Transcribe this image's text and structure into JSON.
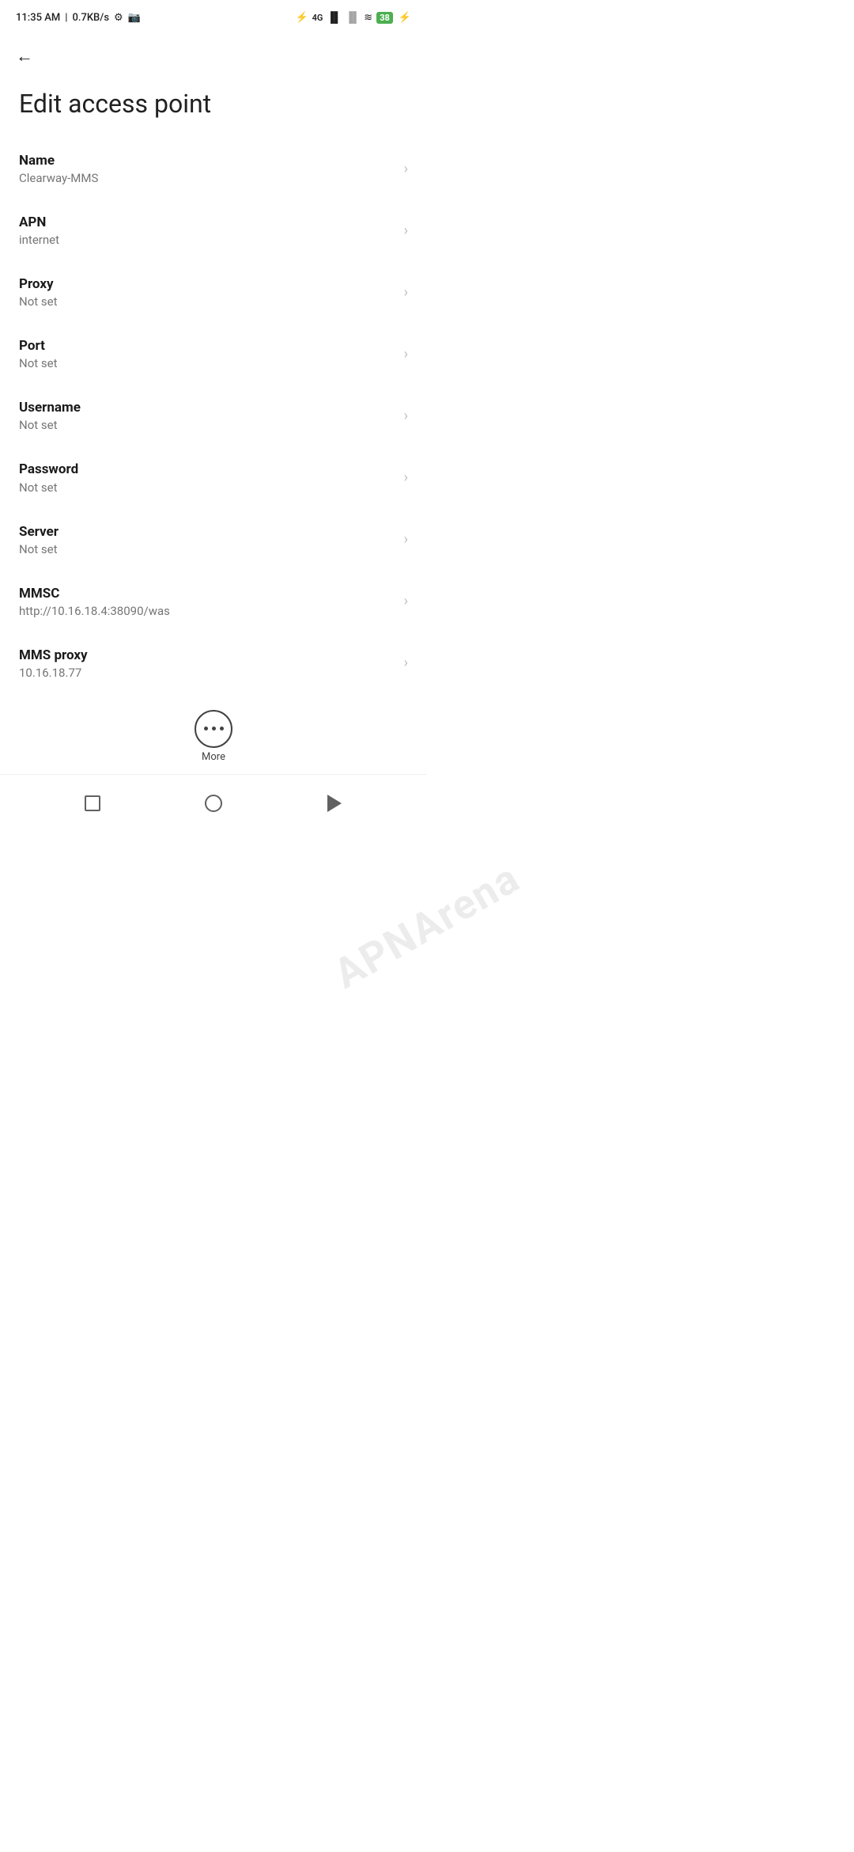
{
  "statusBar": {
    "time": "11:35 AM",
    "speed": "0.7KB/s",
    "battery": "38",
    "icons": {
      "bluetooth": "⁂",
      "signal1": "📶",
      "signal2": "📶",
      "wifi": "🛜"
    }
  },
  "header": {
    "backLabel": "←"
  },
  "pageTitle": "Edit access point",
  "settings": [
    {
      "label": "Name",
      "value": "Clearway-MMS"
    },
    {
      "label": "APN",
      "value": "internet"
    },
    {
      "label": "Proxy",
      "value": "Not set"
    },
    {
      "label": "Port",
      "value": "Not set"
    },
    {
      "label": "Username",
      "value": "Not set"
    },
    {
      "label": "Password",
      "value": "Not set"
    },
    {
      "label": "Server",
      "value": "Not set"
    },
    {
      "label": "MMSC",
      "value": "http://10.16.18.4:38090/was"
    },
    {
      "label": "MMS proxy",
      "value": "10.16.18.77"
    }
  ],
  "more": {
    "label": "More"
  },
  "watermark": "APNArena",
  "bottomNav": {
    "square": "square",
    "circle": "circle",
    "back": "back"
  }
}
